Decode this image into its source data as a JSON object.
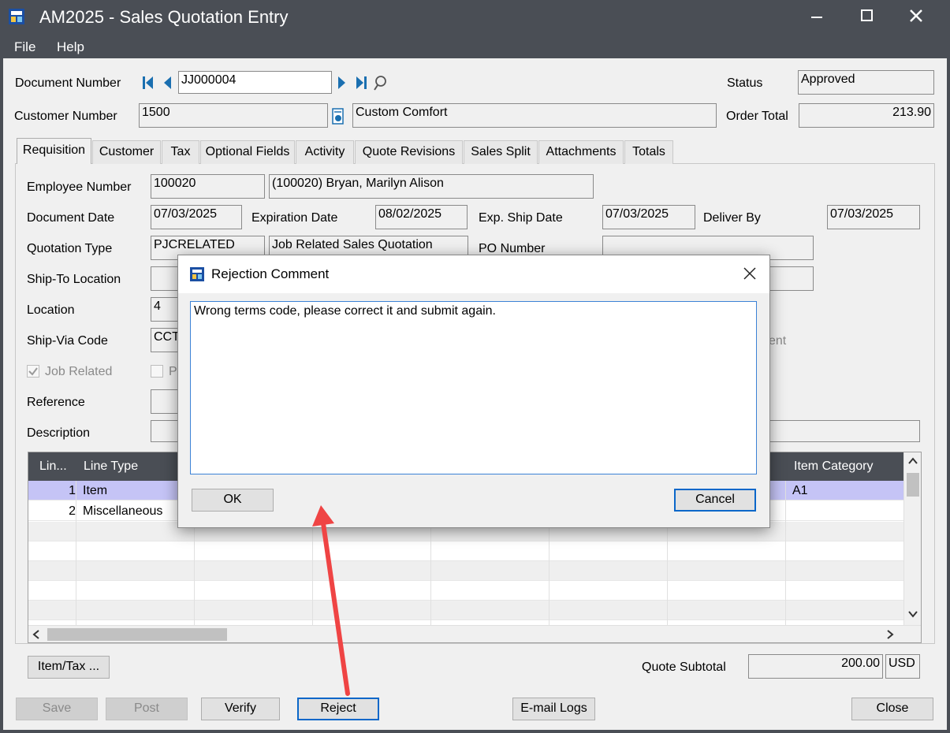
{
  "window": {
    "title": "AM2025 - Sales Quotation Entry"
  },
  "menu": {
    "file": "File",
    "help": "Help"
  },
  "header": {
    "document_number_label": "Document Number",
    "document_number": "JJ000004",
    "status_label": "Status",
    "status": "Approved",
    "customer_number_label": "Customer Number",
    "customer_number": "1500",
    "customer_name": "Custom Comfort",
    "order_total_label": "Order Total",
    "order_total": "213.90"
  },
  "tabs": [
    "Requisition",
    "Customer",
    "Tax",
    "Optional Fields",
    "Activity",
    "Quote Revisions",
    "Sales Split",
    "Attachments",
    "Totals"
  ],
  "requisition": {
    "employee_number_label": "Employee Number",
    "employee_number": "100020",
    "employee_name": "(100020) Bryan, Marilyn Alison",
    "document_date_label": "Document Date",
    "document_date": "07/03/2025",
    "expiration_date_label": "Expiration Date",
    "expiration_date": "08/02/2025",
    "exp_ship_date_label": "Exp. Ship Date",
    "exp_ship_date": "07/03/2025",
    "deliver_by_label": "Deliver By",
    "deliver_by": "07/03/2025",
    "quotation_type_label": "Quotation Type",
    "quotation_type": "PJCRELATED",
    "quotation_type_desc": "Job Related Sales Quotation",
    "po_number_label": "PO Number",
    "ship_to_location_label": "Ship-To Location",
    "location_label": "Location",
    "location": "4",
    "ship_via_code_label": "Ship-Via Code",
    "ship_via_code": "CCT",
    "job_related_label": "Job Related",
    "partial_label": "P",
    "partial_trailing": "ent",
    "reference_label": "Reference",
    "description_label": "Description"
  },
  "grid": {
    "columns": [
      "Lin...",
      "Line Type",
      "Item Category"
    ],
    "rows": [
      {
        "line": "1",
        "type": "Item",
        "category": "A1"
      },
      {
        "line": "2",
        "type": "Miscellaneous",
        "category": ""
      }
    ]
  },
  "footer": {
    "item_tax_button": "Item/Tax ...",
    "quote_subtotal_label": "Quote Subtotal",
    "quote_subtotal": "200.00",
    "currency": "USD",
    "save": "Save",
    "post": "Post",
    "verify": "Verify",
    "reject": "Reject",
    "email_logs": "E-mail Logs",
    "close": "Close"
  },
  "dialog": {
    "title": "Rejection Comment",
    "comment": "Wrong terms code, please correct it and submit again.",
    "ok": "OK",
    "cancel": "Cancel"
  },
  "colors": {
    "titlebar": "#4a4e55",
    "selected_row": "#c5c4f6",
    "focus_border": "#0a67c9",
    "arrow": "#ef4444",
    "nav_arrow": "#1a6fb0"
  }
}
